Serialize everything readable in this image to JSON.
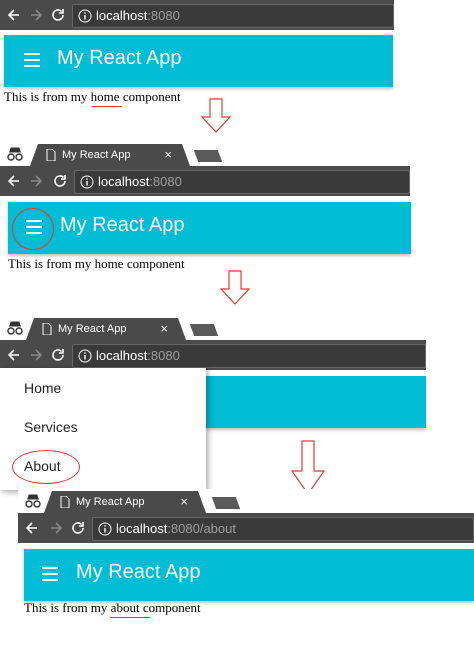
{
  "app": {
    "title": "My React App"
  },
  "browser": {
    "tab_title": "My React App",
    "tab_close": "×",
    "url_host": "localhost",
    "url_port": ":8080",
    "url_about_path": ":8080/about"
  },
  "content": {
    "home": {
      "prefix": "This is from my ",
      "word": "home",
      "suffix": " component"
    },
    "about": {
      "prefix": "This is from my ",
      "word": "about",
      "suffix": " component"
    }
  },
  "drawer": {
    "items": [
      "Home",
      "Services",
      "About"
    ]
  },
  "colors": {
    "appbar": "#00bcd4",
    "annotation": "#e53935",
    "browser_chrome": "#4a4a4a"
  },
  "icons": [
    "back-arrow-icon",
    "forward-arrow-icon",
    "reload-icon",
    "info-icon",
    "incognito-icon",
    "document-icon",
    "hamburger-menu-icon",
    "down-arrow-icon"
  ]
}
